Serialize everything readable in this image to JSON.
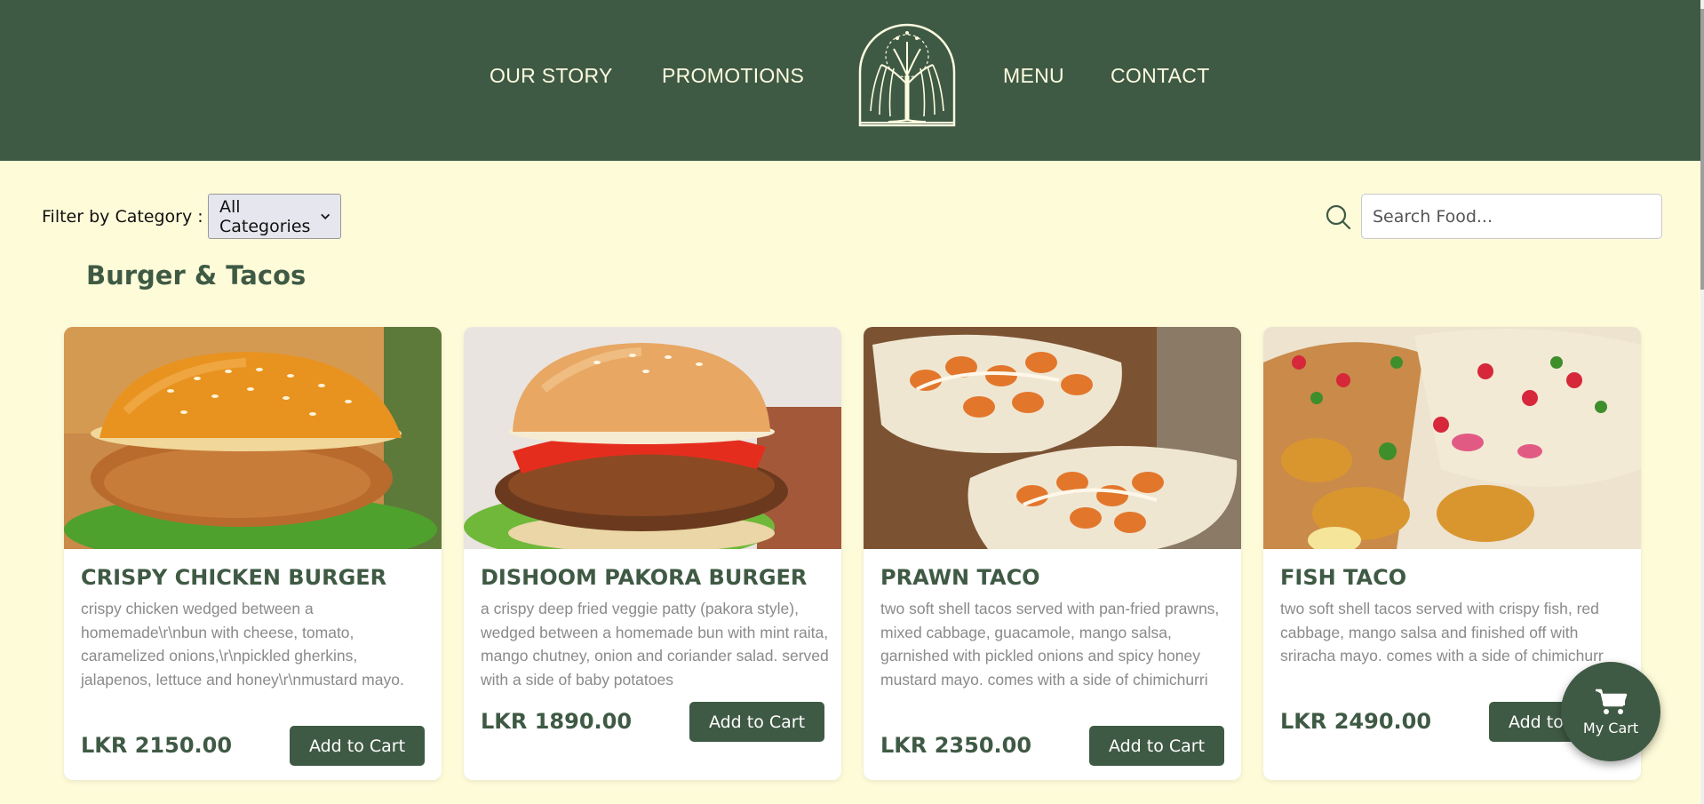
{
  "nav": {
    "left": [
      "OUR STORY",
      "PROMOTIONS"
    ],
    "right": [
      "MENU",
      "CONTACT"
    ]
  },
  "filter": {
    "label": "Filter by Category :",
    "selected": "All Categories"
  },
  "search": {
    "placeholder": "Search Food..."
  },
  "section": {
    "title": "Burger & Tacos"
  },
  "products": [
    {
      "name": "CRISPY CHICKEN BURGER",
      "description": "crispy chicken wedged between a homemade\\r\\nbun with cheese, tomato, caramelized onions,\\r\\npickled gherkins, jalapenos, lettuce and honey\\r\\nmustard mayo.",
      "price": "LKR 2150.00",
      "button": "Add to Cart"
    },
    {
      "name": "DISHOOM PAKORA BURGER",
      "description": "a crispy deep fried veggie patty (pakora style), wedged between a homemade bun with mint raita, mango chutney, onion and coriander salad. served with a side of baby potatoes",
      "price": "LKR 1890.00",
      "button": "Add to Cart"
    },
    {
      "name": "PRAWN TACO",
      "description": "two soft shell tacos served with pan-fried prawns, mixed cabbage, guacamole, mango salsa, garnished with pickled onions and spicy honey mustard mayo. comes with a side of chimichurri",
      "price": "LKR 2350.00",
      "button": "Add to Cart"
    },
    {
      "name": "FISH TACO",
      "description": "two soft shell tacos served with crispy fish, red cabbage, mango salsa and finished off with sriracha mayo. comes with a side of chimichurr",
      "price": "LKR 2490.00",
      "button": "Add to Cart"
    }
  ],
  "cart": {
    "label": "My Cart"
  },
  "colors": {
    "header": "#3f5a44",
    "background": "#fefbd9",
    "nav_text": "#fdfbe0",
    "button": "#3f5a44"
  }
}
